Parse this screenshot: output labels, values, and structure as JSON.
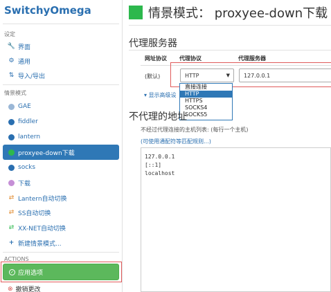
{
  "app": {
    "name": "SwitchyOmega"
  },
  "sidebar": {
    "settings_title": "设定",
    "settings_items": [
      {
        "label": "界面",
        "icon": "wrench-icon"
      },
      {
        "label": "通用",
        "icon": "gear-icon"
      },
      {
        "label": "导入/导出",
        "icon": "import-export-icon"
      }
    ],
    "profiles_title": "情景模式",
    "profiles": [
      {
        "label": "GAE",
        "icon": "globe-icon",
        "color": "#9ab7d6"
      },
      {
        "label": "fiddler",
        "icon": "globe-icon",
        "color": "#2a6fb0"
      },
      {
        "label": "lantern",
        "icon": "globe-icon",
        "color": "#2a6fb0"
      },
      {
        "label": "proxyee-down下载",
        "icon": "globe-icon",
        "color": "#2db84d",
        "active": true
      },
      {
        "label": "socks",
        "icon": "globe-icon",
        "color": "#2a6fb0"
      },
      {
        "label": "下载",
        "icon": "globe-icon",
        "color": "#c58fd6"
      },
      {
        "label": "Lantern自动切换",
        "icon": "switch-icon",
        "color": "#e08a2e"
      },
      {
        "label": "SS自动切换",
        "icon": "switch-icon",
        "color": "#e08a2e"
      },
      {
        "label": "XX-NET自动切换",
        "icon": "switch-icon",
        "color": "#2db84d"
      },
      {
        "label": "新建情景模式...",
        "icon": "plus-icon",
        "color": "#2a6fb0"
      }
    ],
    "actions_title": "ACTIONS",
    "apply_label": "应用选项",
    "revert_label": "撤销更改"
  },
  "main": {
    "profile_color": "#2db84d",
    "title": "情景模式： proxyee-down下载",
    "proxy_section_title": "代理服务器",
    "table_headers": [
      "网址协议",
      "代理协议",
      "代理服务器"
    ],
    "row_scheme": "(默认)",
    "protocol_selected": "HTTP",
    "server_value": "127.0.0.1",
    "protocol_options": [
      "直接连接",
      "HTTP",
      "HTTPS",
      "SOCKS4",
      "SOCKS5"
    ],
    "show_advanced": "显示高级设",
    "bypass_title": "不代理的地址",
    "bypass_note": "不经过代理连接的主机列表: (每行一个主机)",
    "wildcard_link": "(可使用通配符等匹配规则...)",
    "bypass_list": [
      "127.0.0.1",
      "[::1]",
      "localhost"
    ]
  }
}
